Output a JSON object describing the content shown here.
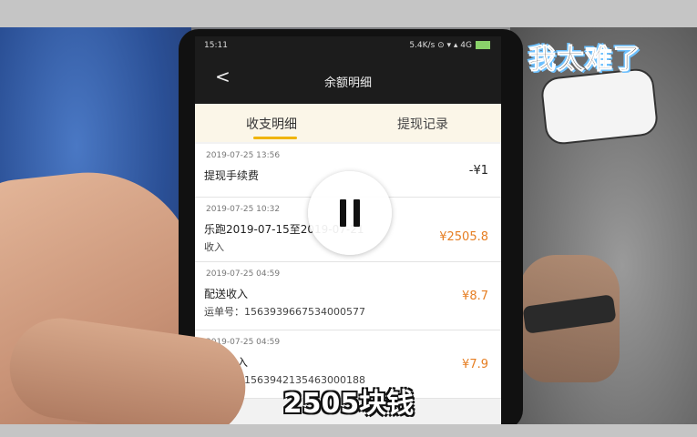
{
  "phone": {
    "status_time": "15:11",
    "status_network": "5.4K/s ⊙ ▾ ▴ 4G",
    "nav_title": "余额明细",
    "back_glyph": "<",
    "tabs": [
      "收支明细",
      "提现记录"
    ],
    "active_tab_color": "#f0b400",
    "transactions": [
      {
        "date": "2019-07-25 13:56",
        "name": "提现手续费",
        "amount": "-¥1",
        "subtitle": ""
      },
      {
        "date": "2019-07-25 10:32",
        "name": "乐跑2019-07-15至2019-07-21",
        "subtitle": "收入",
        "amount": "¥2505.8"
      },
      {
        "date": "2019-07-25 04:59",
        "name": "配送收入",
        "subtitle": "运单号：1563939667534000577",
        "amount": "¥8.7"
      },
      {
        "date": "2019-07-25 04:59",
        "name": "配送收入",
        "subtitle": "运单号：1563942135463000188",
        "amount": "¥7.9"
      }
    ]
  },
  "overlay": {
    "sticker_text": "我太难了",
    "caption": "2505块钱",
    "pause_icon": "pause-icon"
  }
}
